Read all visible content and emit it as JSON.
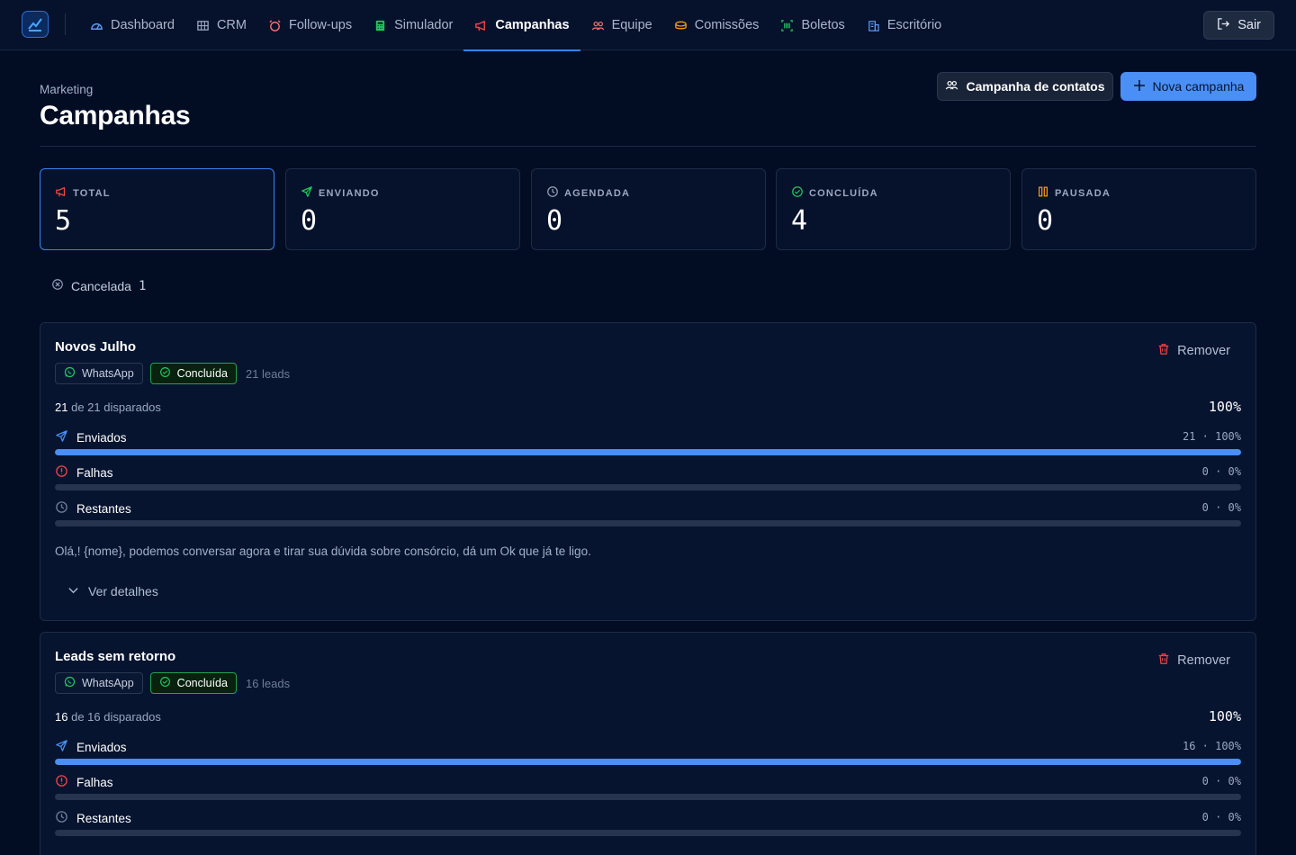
{
  "nav": {
    "items": [
      {
        "label": "Dashboard",
        "icon": "gauge-icon",
        "active": false
      },
      {
        "label": "CRM",
        "icon": "kanban-icon",
        "active": false
      },
      {
        "label": "Follow-ups",
        "icon": "alarm-icon",
        "active": false
      },
      {
        "label": "Simulador",
        "icon": "calculator-icon",
        "active": false
      },
      {
        "label": "Campanhas",
        "icon": "megaphone-icon",
        "active": true
      },
      {
        "label": "Equipe",
        "icon": "users-icon",
        "active": false
      },
      {
        "label": "Comissões",
        "icon": "coins-icon",
        "active": false
      },
      {
        "label": "Boletos",
        "icon": "barcode-icon",
        "active": false
      },
      {
        "label": "Escritório",
        "icon": "building-icon",
        "active": false
      }
    ],
    "logout_label": "Sair"
  },
  "header": {
    "breadcrumb": "Marketing",
    "title": "Campanhas",
    "contacts_button": "Campanha de contatos",
    "new_button": "Nova campanha"
  },
  "stats": [
    {
      "label": "TOTAL",
      "value": "5",
      "icon": "megaphone-icon",
      "color": "#ef4444"
    },
    {
      "label": "ENVIANDO",
      "value": "0",
      "icon": "send-icon",
      "color": "#22c55e"
    },
    {
      "label": "AGENDADA",
      "value": "0",
      "icon": "clock-icon",
      "color": "#94a3b8"
    },
    {
      "label": "CONCLUÍDA",
      "value": "4",
      "icon": "check-circle-icon",
      "color": "#22c55e"
    },
    {
      "label": "PAUSADA",
      "value": "0",
      "icon": "pause-icon",
      "color": "#f59e0b"
    }
  ],
  "cancelled": {
    "label": "Cancelada",
    "count": "1"
  },
  "campaigns": [
    {
      "title": "Novos Julho",
      "remove_label": "Remover",
      "channel": "WhatsApp",
      "status": "Concluída",
      "leads": "21 leads",
      "dispatched_count": "21",
      "dispatched_text": "de 21 disparados",
      "percent": "100%",
      "metrics": [
        {
          "label": "Enviados",
          "value": "21 · 100%",
          "fill": 1.0
        },
        {
          "label": "Falhas",
          "value": "0 · 0%",
          "fill": 0.0
        },
        {
          "label": "Restantes",
          "value": "0 · 0%",
          "fill": 0.0
        }
      ],
      "message": "Olá,! {nome}, podemos conversar agora e tirar sua dúvida sobre consórcio, dá um Ok que já te ligo.",
      "details_label": "Ver detalhes"
    },
    {
      "title": "Leads sem retorno",
      "remove_label": "Remover",
      "channel": "WhatsApp",
      "status": "Concluída",
      "leads": "16 leads",
      "dispatched_count": "16",
      "dispatched_text": "de 16 disparados",
      "percent": "100%",
      "metrics": [
        {
          "label": "Enviados",
          "value": "16 · 100%",
          "fill": 1.0
        },
        {
          "label": "Falhas",
          "value": "0 · 0%",
          "fill": 0.0
        },
        {
          "label": "Restantes",
          "value": "0 · 0%",
          "fill": 0.0
        }
      ]
    }
  ],
  "colors": {
    "accent": "#4a8ff5",
    "success": "#22c55e",
    "danger": "#ef4444",
    "background": "#020d24"
  }
}
